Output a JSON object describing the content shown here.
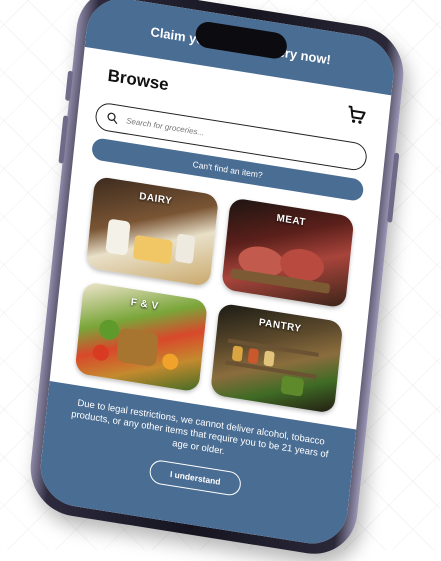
{
  "banner": {
    "text": "Claim your first delivery now!"
  },
  "header": {
    "title": "Browse"
  },
  "search": {
    "placeholder": "Search for groceries..."
  },
  "cant_find": {
    "label": "Can't find an item?"
  },
  "categories": [
    {
      "label": "DAIRY"
    },
    {
      "label": "MEAT"
    },
    {
      "label": "F & V"
    },
    {
      "label": "PANTRY"
    }
  ],
  "notice": {
    "text": "Due to legal restrictions, we cannot deliver alcohol, tobacco products, or any other items that require you to be 21 years of age or older.",
    "button_label": "I understand"
  },
  "colors": {
    "brand": "#4a6d93",
    "frame": "#15141f"
  },
  "icons": {
    "cart": "cart-icon",
    "search": "search-icon"
  }
}
